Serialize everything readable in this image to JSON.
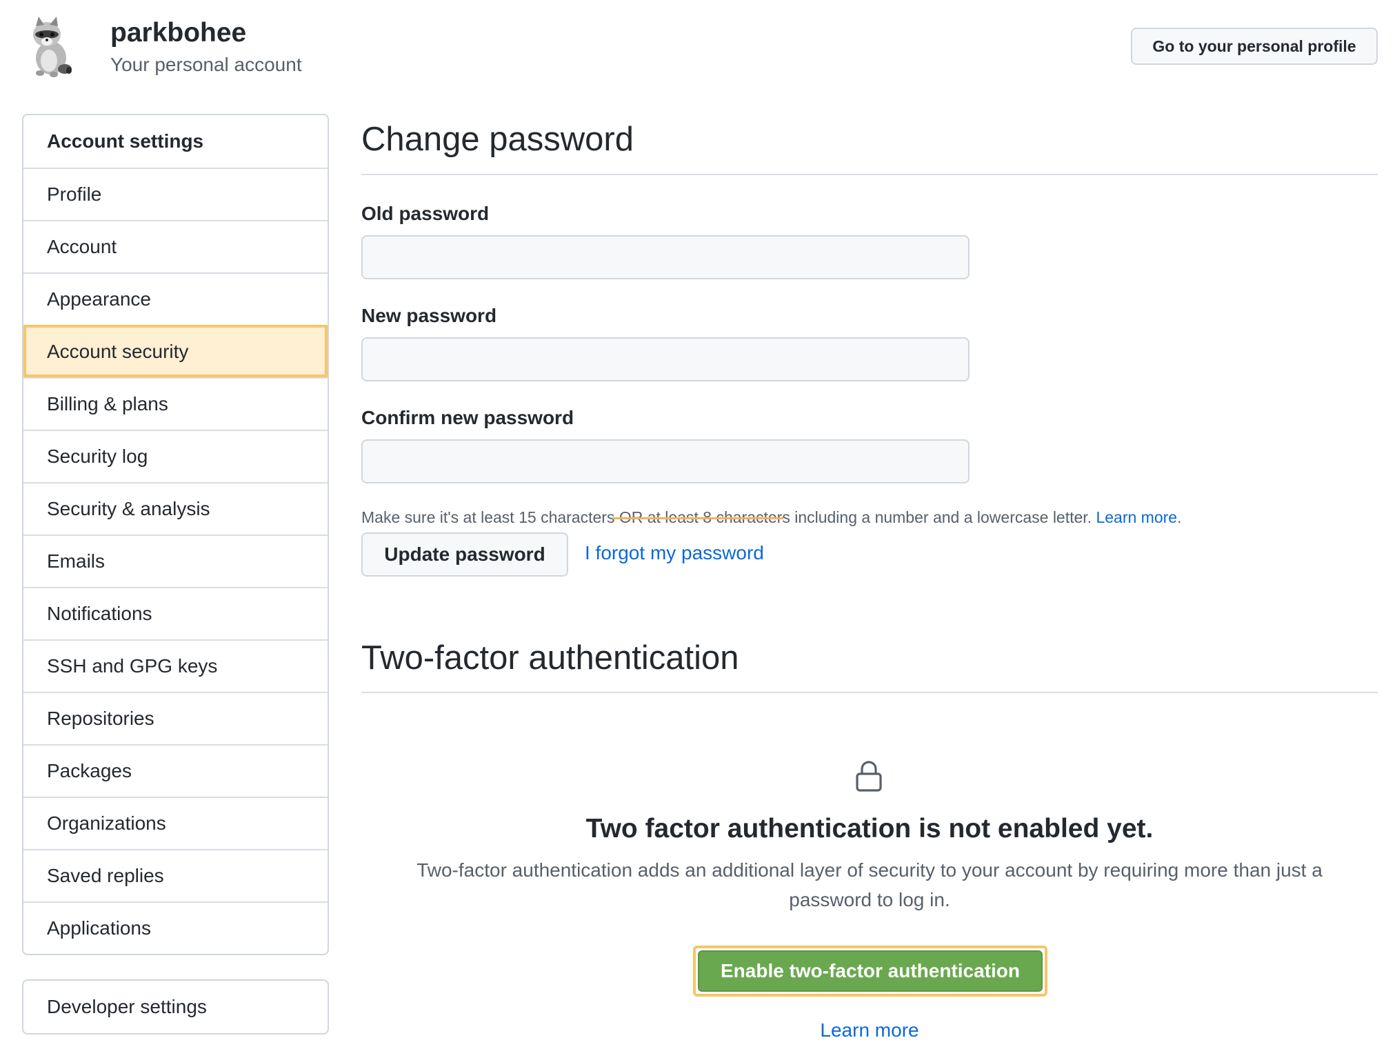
{
  "user": {
    "name": "parkbohee",
    "subtitle": "Your personal account",
    "profile_button": "Go to your personal profile"
  },
  "sidebar": {
    "heading": "Account settings",
    "items": [
      {
        "label": "Profile"
      },
      {
        "label": "Account"
      },
      {
        "label": "Appearance"
      },
      {
        "label": "Account security",
        "selected": true
      },
      {
        "label": "Billing & plans"
      },
      {
        "label": "Security log"
      },
      {
        "label": "Security & analysis"
      },
      {
        "label": "Emails"
      },
      {
        "label": "Notifications"
      },
      {
        "label": "SSH and GPG keys"
      },
      {
        "label": "Repositories"
      },
      {
        "label": "Packages"
      },
      {
        "label": "Organizations"
      },
      {
        "label": "Saved replies"
      },
      {
        "label": "Applications"
      }
    ],
    "developer": "Developer settings"
  },
  "change_password": {
    "title": "Change password",
    "old_label": "Old password",
    "new_label": "New password",
    "confirm_label": "Confirm new password",
    "note": "Make sure it's at least 15 characters OR at least 8 characters including a number and a lowercase letter.",
    "note_link": "Learn more",
    "update_button": "Update password",
    "forgot_link": "I forgot my password"
  },
  "two_factor": {
    "title": "Two-factor authentication",
    "status_title": "Two factor authentication is not enabled yet.",
    "description": "Two-factor authentication adds an additional layer of security to your account by requiring more than just a password to log in.",
    "enable_button": "Enable two-factor authentication",
    "learn_more": "Learn more"
  },
  "colors": {
    "accent_link": "#0969da",
    "enable_green": "#6aa84f",
    "highlight_orange": "#f9c46a",
    "selected_bg": "#ffefd3"
  },
  "icons": {
    "avatar": "raccoon-avatar",
    "lock": "lock-icon"
  }
}
